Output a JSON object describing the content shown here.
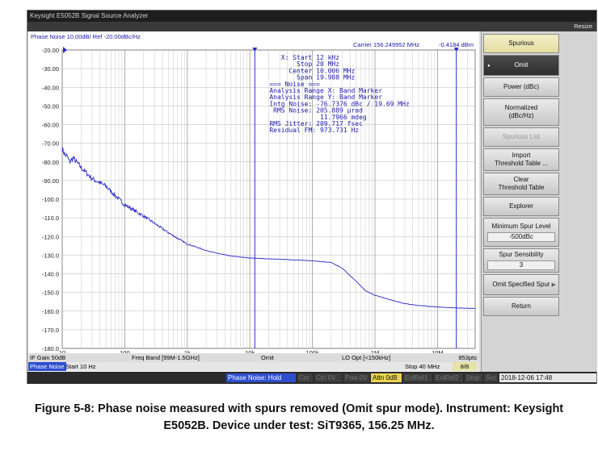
{
  "window": {
    "title": "Keysight E5052B Signal Source Analyzer",
    "resize_label": "Resize"
  },
  "plot": {
    "header": "Phase Noise 10.00dB/ Ref -20.00dBc/Hz",
    "carrier": "Carrier 156.249952 MHz",
    "marker_readout": "-0.4184 dBm",
    "y_ticks": [
      "-20.00",
      "-30.00",
      "-40.00",
      "-50.00",
      "-60.00",
      "-70.00",
      "-80.00",
      "-90.00",
      "-100.0",
      "-110.0",
      "-120.0",
      "-130.0",
      "-140.0",
      "-150.0",
      "-160.0",
      "-170.0",
      "-180.0"
    ],
    "x_ticks": [
      "10",
      "100",
      "1k",
      "10k",
      "100k",
      "1M",
      "10M"
    ],
    "info_lines": [
      "   X: Start 12 kHz",
      "       Stop 20 MHz",
      "     Center 10.006 MHz",
      "       Span 19.988 MHz",
      "=== Noise ===",
      "Analysis Range X: Band Marker",
      "Analysis Range Y: Band Marker",
      "Intg Noise: -76.7376 dBc / 19.69 MHz",
      " RMS Noise: 205.889 µrad",
      "             11.7966 mdeg",
      "RMS Jitter: 209.717 fsec",
      "Residual FM: 973.731 Hz"
    ]
  },
  "status1": {
    "if_gain": "IF Gain 50dB",
    "freq_band": "Freq Band [99M-1.5GHz]",
    "omit": "Omit",
    "lo_opt": "LO Opt [<150kHz]",
    "points": "853pts"
  },
  "status2": {
    "measure": "Phase Noise",
    "start": "Start 10 Hz",
    "stop": "Stop 40 MHz",
    "count": "8/8"
  },
  "bottombar": {
    "mode": "Phase Noise: Hold",
    "cor": "Cor",
    "ctrl": "Ctrl  0V",
    "pow": "Pow  0V",
    "attn": "Attn 0dB",
    "extref1": "ExtRef1",
    "extref2": "ExtRef2",
    "stop": "Stop",
    "svc": "Svc",
    "datetime": "2018-12-06 17:48"
  },
  "softkeys": {
    "title": "Spurious",
    "omit": "Omit",
    "power": "Power (dBc)",
    "normalized": [
      "Normalized",
      "(dBc/Hz)"
    ],
    "spurious_list": "Spurious List",
    "import": [
      "Import",
      "Threshold Table ..."
    ],
    "clear": [
      "Clear",
      "Threshold Table"
    ],
    "explorer": "Explorer",
    "min_spur_level": "Minimum Spur Level",
    "min_spur_value": "-500dBc",
    "spur_sensibility": "Spur Sensibility",
    "spur_sensibility_value": "3",
    "omit_specified": "Omit Specified Spur",
    "return": "Return"
  },
  "chart_data": {
    "type": "line",
    "title": "Phase Noise 10.00dB/ Ref -20.00dBc/Hz",
    "xlabel": "",
    "ylabel": "",
    "x_scale": "log",
    "xlim": [
      10,
      40000000
    ],
    "ylim": [
      -180,
      -20
    ],
    "grid": true,
    "series": [
      {
        "x": [
          10,
          11,
          12,
          13,
          15,
          20,
          30,
          50,
          70,
          100,
          200,
          300,
          500,
          700,
          1000,
          2000,
          3000,
          5000,
          10000,
          20000,
          50000,
          100000,
          200000,
          300000,
          400000,
          500000,
          700000,
          1000000,
          2000000,
          3000000,
          5000000,
          10000000,
          20000000,
          40000000
        ],
        "y": [
          -73,
          -76,
          -77,
          -80,
          -78,
          -83,
          -89,
          -93,
          -98,
          -103,
          -109,
          -113,
          -118,
          -121,
          -124,
          -127.5,
          -129,
          -130.5,
          -131.5,
          -132,
          -132.5,
          -133,
          -134,
          -137,
          -141,
          -144,
          -149,
          -151.5,
          -154.5,
          -156,
          -157,
          -157.8,
          -158.3,
          -158.6
        ]
      }
    ],
    "markers": {
      "band_start": 12000,
      "band_stop": 20000000
    }
  },
  "figure_caption": [
    "Figure 5-8: Phase noise measured with spurs removed (Omit spur mode). Instrument: Keysight",
    "E5052B. Device under test: SiT9365, 156.25 MHz."
  ]
}
